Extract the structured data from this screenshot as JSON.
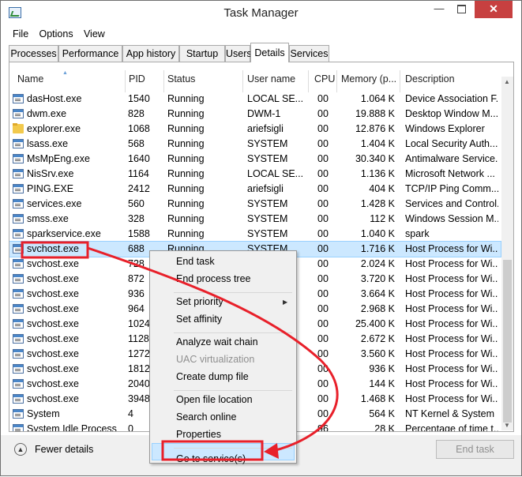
{
  "window": {
    "title": "Task Manager",
    "minimize": "—",
    "close": "✕"
  },
  "menu": [
    "File",
    "Options",
    "View"
  ],
  "tabs": [
    "Processes",
    "Performance",
    "App history",
    "Startup",
    "Users",
    "Details",
    "Services"
  ],
  "active_tab": "Details",
  "columns": [
    "Name",
    "PID",
    "Status",
    "User name",
    "CPU",
    "Memory (p...",
    "Description"
  ],
  "rows": [
    {
      "name": "dasHost.exe",
      "pid": "1540",
      "status": "Running",
      "user": "LOCAL SE...",
      "cpu": "00",
      "mem": "1.064 K",
      "desc": "Device Association F...",
      "icon": "process-icon"
    },
    {
      "name": "dwm.exe",
      "pid": "828",
      "status": "Running",
      "user": "DWM-1",
      "cpu": "00",
      "mem": "19.888 K",
      "desc": "Desktop Window M...",
      "icon": "process-icon"
    },
    {
      "name": "explorer.exe",
      "pid": "1068",
      "status": "Running",
      "user": "ariefsigli",
      "cpu": "00",
      "mem": "12.876 K",
      "desc": "Windows Explorer",
      "icon": "folder-icon"
    },
    {
      "name": "lsass.exe",
      "pid": "568",
      "status": "Running",
      "user": "SYSTEM",
      "cpu": "00",
      "mem": "1.404 K",
      "desc": "Local Security Auth...",
      "icon": "process-icon"
    },
    {
      "name": "MsMpEng.exe",
      "pid": "1640",
      "status": "Running",
      "user": "SYSTEM",
      "cpu": "00",
      "mem": "30.340 K",
      "desc": "Antimalware Service...",
      "icon": "process-icon"
    },
    {
      "name": "NisSrv.exe",
      "pid": "1164",
      "status": "Running",
      "user": "LOCAL SE...",
      "cpu": "00",
      "mem": "1.136 K",
      "desc": "Microsoft Network ...",
      "icon": "process-icon"
    },
    {
      "name": "PING.EXE",
      "pid": "2412",
      "status": "Running",
      "user": "ariefsigli",
      "cpu": "00",
      "mem": "404 K",
      "desc": "TCP/IP Ping Comm...",
      "icon": "process-icon"
    },
    {
      "name": "services.exe",
      "pid": "560",
      "status": "Running",
      "user": "SYSTEM",
      "cpu": "00",
      "mem": "1.428 K",
      "desc": "Services and Control...",
      "icon": "process-icon"
    },
    {
      "name": "smss.exe",
      "pid": "328",
      "status": "Running",
      "user": "SYSTEM",
      "cpu": "00",
      "mem": "112 K",
      "desc": "Windows Session M...",
      "icon": "process-icon"
    },
    {
      "name": "sparkservice.exe",
      "pid": "1588",
      "status": "Running",
      "user": "SYSTEM",
      "cpu": "00",
      "mem": "1.040 K",
      "desc": "spark",
      "icon": "process-icon"
    },
    {
      "name": "svchost.exe",
      "pid": "688",
      "status": "Running",
      "user": "SYSTEM",
      "cpu": "00",
      "mem": "1.716 K",
      "desc": "Host Process for Wi...",
      "icon": "process-icon",
      "selected": true
    },
    {
      "name": "svchost.exe",
      "pid": "728",
      "status": "",
      "user": "",
      "cpu": "00",
      "mem": "2.024 K",
      "desc": "Host Process for Wi...",
      "icon": "process-icon"
    },
    {
      "name": "svchost.exe",
      "pid": "872",
      "status": "",
      "user": "",
      "cpu": "00",
      "mem": "3.720 K",
      "desc": "Host Process for Wi...",
      "icon": "process-icon"
    },
    {
      "name": "svchost.exe",
      "pid": "936",
      "status": "",
      "user": "",
      "cpu": "00",
      "mem": "3.664 K",
      "desc": "Host Process for Wi...",
      "icon": "process-icon"
    },
    {
      "name": "svchost.exe",
      "pid": "964",
      "status": "",
      "user": "",
      "cpu": "00",
      "mem": "2.968 K",
      "desc": "Host Process for Wi...",
      "icon": "process-icon"
    },
    {
      "name": "svchost.exe",
      "pid": "1024",
      "status": "",
      "user": "",
      "cpu": "00",
      "mem": "25.400 K",
      "desc": "Host Process for Wi...",
      "icon": "process-icon"
    },
    {
      "name": "svchost.exe",
      "pid": "1128",
      "status": "",
      "user": "",
      "cpu": "00",
      "mem": "2.672 K",
      "desc": "Host Process for Wi...",
      "icon": "process-icon"
    },
    {
      "name": "svchost.exe",
      "pid": "1272",
      "status": "",
      "user": "",
      "cpu": "00",
      "mem": "3.560 K",
      "desc": "Host Process for Wi...",
      "icon": "process-icon"
    },
    {
      "name": "svchost.exe",
      "pid": "1812",
      "status": "",
      "user": "",
      "cpu": "00",
      "mem": "936 K",
      "desc": "Host Process for Wi...",
      "icon": "process-icon"
    },
    {
      "name": "svchost.exe",
      "pid": "2040",
      "status": "",
      "user": "",
      "cpu": "00",
      "mem": "144 K",
      "desc": "Host Process for Wi...",
      "icon": "process-icon"
    },
    {
      "name": "svchost.exe",
      "pid": "3948",
      "status": "",
      "user": "",
      "cpu": "00",
      "mem": "1.468 K",
      "desc": "Host Process for Wi...",
      "icon": "process-icon"
    },
    {
      "name": "System",
      "pid": "4",
      "status": "",
      "user": "",
      "cpu": "00",
      "mem": "564 K",
      "desc": "NT Kernel & System",
      "icon": "process-icon"
    },
    {
      "name": "System Idle Process",
      "pid": "0",
      "status": "",
      "user": "",
      "cpu": "96",
      "mem": "28 K",
      "desc": "Percentage of time t...",
      "icon": "process-icon"
    }
  ],
  "context_menu": [
    {
      "label": "End task",
      "name": "ctx-end-task",
      "enabled": true
    },
    {
      "label": "End process tree",
      "name": "ctx-end-process-tree",
      "enabled": true
    },
    {
      "sep": true
    },
    {
      "label": "Set priority",
      "name": "ctx-set-priority",
      "enabled": true,
      "submenu": true
    },
    {
      "label": "Set affinity",
      "name": "ctx-set-affinity",
      "enabled": true
    },
    {
      "sep": true
    },
    {
      "label": "Analyze wait chain",
      "name": "ctx-analyze-wait-chain",
      "enabled": true
    },
    {
      "label": "UAC virtualization",
      "name": "ctx-uac-virtualization",
      "enabled": false
    },
    {
      "label": "Create dump file",
      "name": "ctx-create-dump-file",
      "enabled": true
    },
    {
      "sep": true
    },
    {
      "label": "Open file location",
      "name": "ctx-open-file-location",
      "enabled": true
    },
    {
      "label": "Search online",
      "name": "ctx-search-online",
      "enabled": true
    },
    {
      "label": "Properties",
      "name": "ctx-properties",
      "enabled": true
    },
    {
      "sep": true
    },
    {
      "label": "Go to service(s)",
      "name": "ctx-go-to-services",
      "enabled": true,
      "highlighted": true
    }
  ],
  "footer": {
    "fewer_details": "Fewer details",
    "end_task": "End task"
  },
  "colors": {
    "selection": "#cce8ff",
    "annotation": "#e8202a",
    "close_button": "#c74040"
  }
}
